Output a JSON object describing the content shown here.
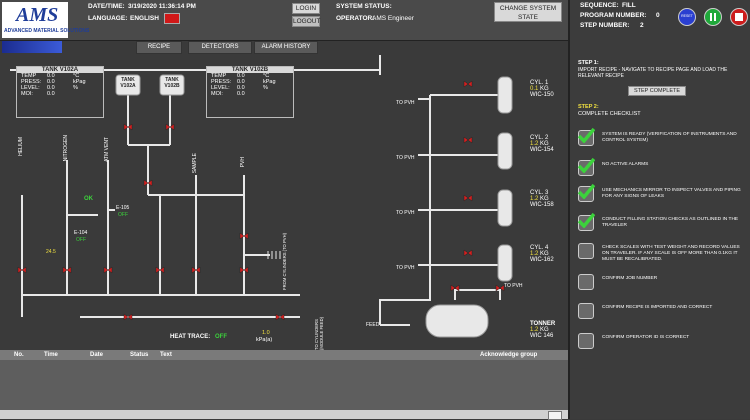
{
  "header": {
    "logo_text": "AMS",
    "logo_sub": "ADVANCED MATERIAL SOLUTIONS",
    "datetime_label": "DATE/TIME:",
    "datetime_value": "3/19/2020 11:36:14 PM",
    "language_label": "LANGUAGE:",
    "language_value": "ENGLISH",
    "login_label": "LOGIN",
    "logout_label": "LOGOUT",
    "system_status_label": "SYSTEM STATUS:",
    "operator_label": "OPERATOR:",
    "operator_value": "AMS Engineer",
    "change_state_label": "CHANGE SYSTEM STATE"
  },
  "tabs": [
    "RECIPE",
    "DETECTORS",
    "ALARM HISTORY"
  ],
  "tank_a": {
    "title": "TANK V102A",
    "rows": [
      {
        "k": "TEMP",
        "v": "0.0",
        "u": "°C"
      },
      {
        "k": "PRESS:",
        "v": "0.0",
        "u": "kPag"
      },
      {
        "k": "LEVEL:",
        "v": "0.0",
        "u": "%"
      },
      {
        "k": "MOI:",
        "v": "0.0",
        "u": ""
      }
    ]
  },
  "tank_b": {
    "title": "TANK V102B",
    "rows": [
      {
        "k": "TEMP",
        "v": "0.0",
        "u": "°C"
      },
      {
        "k": "PRESS:",
        "v": "0.0",
        "u": "kPag"
      },
      {
        "k": "LEVEL:",
        "v": "0.0",
        "u": "%"
      },
      {
        "k": "MOI:",
        "v": "0.0",
        "u": ""
      }
    ]
  },
  "tank_icons": [
    "TANK V102A",
    "TANK V102B"
  ],
  "lines": [
    "HELIUM",
    "NITROGEN",
    "ATM VENT",
    "SAMPLE",
    "PVH"
  ],
  "instruments": {
    "ok": "OK",
    "e105": "E-105",
    "e105_state": "OFF",
    "e104": "E-104",
    "e104_state": "OFF",
    "e104_val": "24.5",
    "heat_trace_label": "HEAT TRACE:",
    "heat_trace_state": "OFF",
    "flow_val": "1.0",
    "flow_unit": "kPa(a)",
    "from_cyl": "FROM CYLINDERS (TO PVH)",
    "to_cyl": "TO CYLINDERS (MODULE FEED)"
  },
  "cylinders": [
    {
      "name": "CYL. 1",
      "val": "0.1",
      "unit": "KG",
      "wic": "WIC-150",
      "to": "TO PVH"
    },
    {
      "name": "CYL. 2",
      "val": "1.2",
      "unit": "KG",
      "wic": "WIC-154",
      "to": "TO PVH"
    },
    {
      "name": "CYL. 3",
      "val": "1.2",
      "unit": "KG",
      "wic": "WIC-158",
      "to": "TO PVH"
    },
    {
      "name": "CYL. 4",
      "val": "1.2",
      "unit": "KG",
      "wic": "WIC-162",
      "to": "TO PVH"
    }
  ],
  "tonner": {
    "name": "TONNER",
    "val": "1.2",
    "unit": "KG",
    "wic": "WIC 146",
    "feed": "FEED",
    "to": "TO PVH"
  },
  "alarm_table": {
    "columns": [
      "No.",
      "Time",
      "Date",
      "Status",
      "Text"
    ],
    "ack_label": "Acknowledge group"
  },
  "right_panel": {
    "sequence_label": "SEQUENCE:",
    "sequence_value": "FILL",
    "program_label": "PROGRAM NUMBER:",
    "program_value": "0",
    "step_label": "STEP NUMBER:",
    "step_value": "2",
    "reset_label": "RESET",
    "step1_title": "STEP 1:",
    "step1_text": "IMPORT RECIPE - NAVIGATE TO RECIPE PAGE AND LOAD THE RELEVANT RECIPE",
    "step_complete_label": "STEP COMPLETE",
    "step2_title": "STEP 2:",
    "step2_text": "COMPLETE CHECKLIST",
    "checklist": [
      {
        "text": "SYSTEM IS READY (VERIFICATION OF INSTRUMENTS AND CONTROL SYSTEM)",
        "checked": true
      },
      {
        "text": "NO ACTIVE ALARMS",
        "checked": true
      },
      {
        "text": "USE MECHANICS MIRROR TO INSPECT VALVES AND PIPING FOR ANY SIGNS OF LEAKS",
        "checked": true
      },
      {
        "text": "CONDUCT FILLING STATION CHECKS AS OUTLINED IN THE TRAVELER",
        "checked": true
      },
      {
        "text": "CHECK SCALES WITH TEST WEIGHT AND RECORD VALUES ON TRAVELER. IF ANY SCALE IS OFF MORE THAN 0.1KG IT MUST BE RECALIBRATED.",
        "checked": false
      },
      {
        "text": "CONFIRM JOB NUMBER",
        "checked": false
      },
      {
        "text": "CONFIRM RECIPE IS IMPORTED AND CORRECT",
        "checked": false
      },
      {
        "text": "CONFIRM OPERATOR ID IS CORRECT",
        "checked": false
      }
    ]
  },
  "colors": {
    "ok_green": "#3cd23c",
    "value_yellow": "#f0e040",
    "valve_red": "#d42020",
    "reset_blue": "#2a3fd0",
    "run_green": "#1fa83a",
    "stop_red": "#cc1c1c"
  }
}
